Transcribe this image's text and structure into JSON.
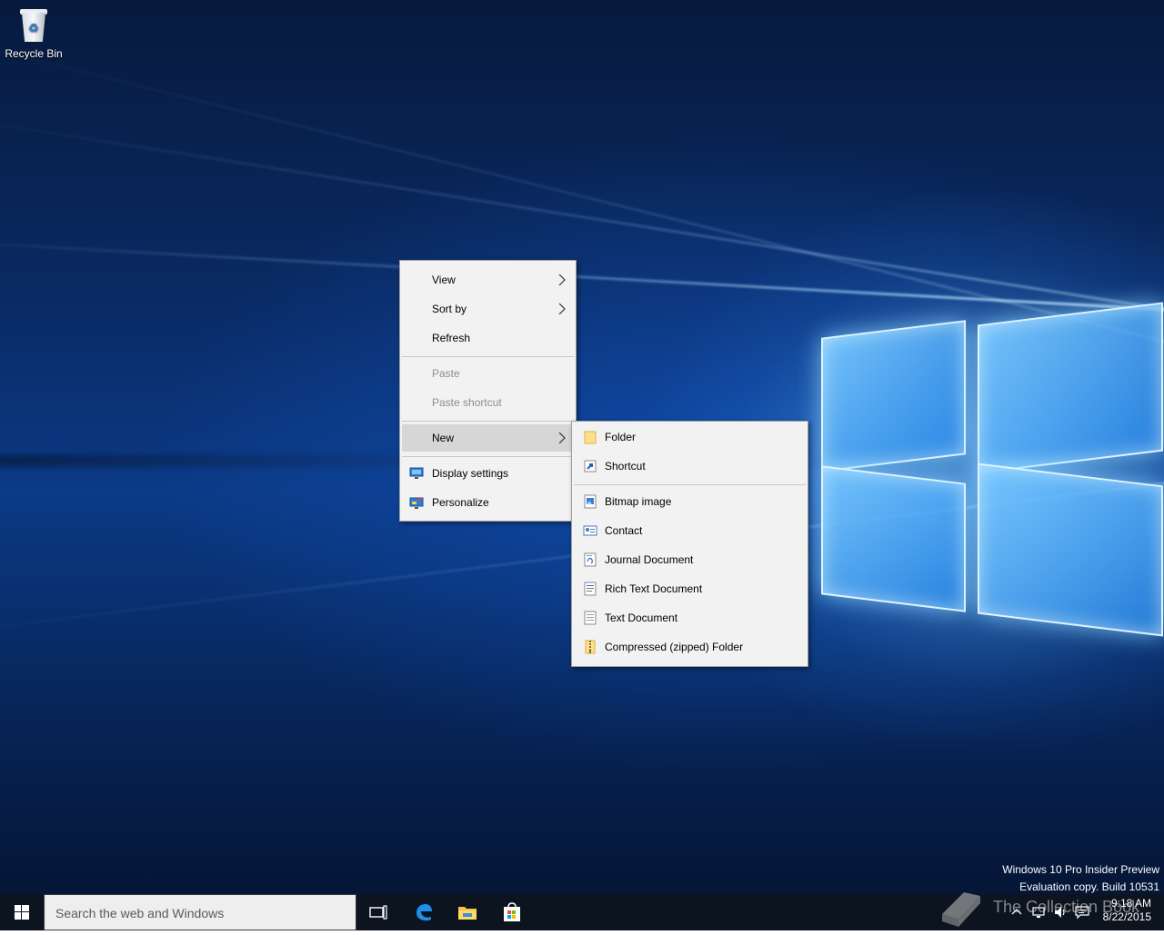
{
  "desktop": {
    "icons": [
      {
        "label": "Recycle Bin",
        "icon": "recycle-bin-icon"
      }
    ]
  },
  "context_menu": {
    "items": [
      {
        "label": "View",
        "has_submenu": true,
        "enabled": true
      },
      {
        "label": "Sort by",
        "has_submenu": true,
        "enabled": true
      },
      {
        "label": "Refresh",
        "enabled": true
      },
      {
        "label": "Paste",
        "enabled": false
      },
      {
        "label": "Paste shortcut",
        "enabled": false
      },
      {
        "label": "New",
        "has_submenu": true,
        "enabled": true,
        "highlighted": true
      },
      {
        "label": "Display settings",
        "icon": "display-settings-icon",
        "enabled": true
      },
      {
        "label": "Personalize",
        "icon": "personalize-icon",
        "enabled": true
      }
    ]
  },
  "new_submenu": {
    "items": [
      {
        "label": "Folder",
        "icon": "folder-icon"
      },
      {
        "label": "Shortcut",
        "icon": "shortcut-icon"
      },
      {
        "label": "Bitmap image",
        "icon": "bitmap-image-icon"
      },
      {
        "label": "Contact",
        "icon": "contact-icon"
      },
      {
        "label": "Journal Document",
        "icon": "journal-document-icon"
      },
      {
        "label": "Rich Text Document",
        "icon": "rich-text-document-icon"
      },
      {
        "label": "Text Document",
        "icon": "text-document-icon"
      },
      {
        "label": "Compressed (zipped) Folder",
        "icon": "zipped-folder-icon"
      }
    ]
  },
  "build_info": {
    "line1": "Windows 10 Pro Insider Preview",
    "line2": "Evaluation copy. Build 10531"
  },
  "taskbar": {
    "search_placeholder": "Search the web and Windows",
    "pinned": [
      {
        "name": "Task View",
        "icon": "task-view-icon"
      },
      {
        "name": "Microsoft Edge",
        "icon": "edge-icon"
      },
      {
        "name": "File Explorer",
        "icon": "file-explorer-icon"
      },
      {
        "name": "Store",
        "icon": "store-icon"
      }
    ],
    "clock": {
      "time": "9:18 AM",
      "date": "8/22/2015"
    }
  },
  "watermark": {
    "text": "The Collection Book"
  },
  "colors": {
    "taskbar": "#0c1420",
    "menu_bg": "#f2f2f2",
    "menu_highlight": "#d6d6d6",
    "disabled_text": "#8d8d8d",
    "accent": "#1e90ff"
  }
}
